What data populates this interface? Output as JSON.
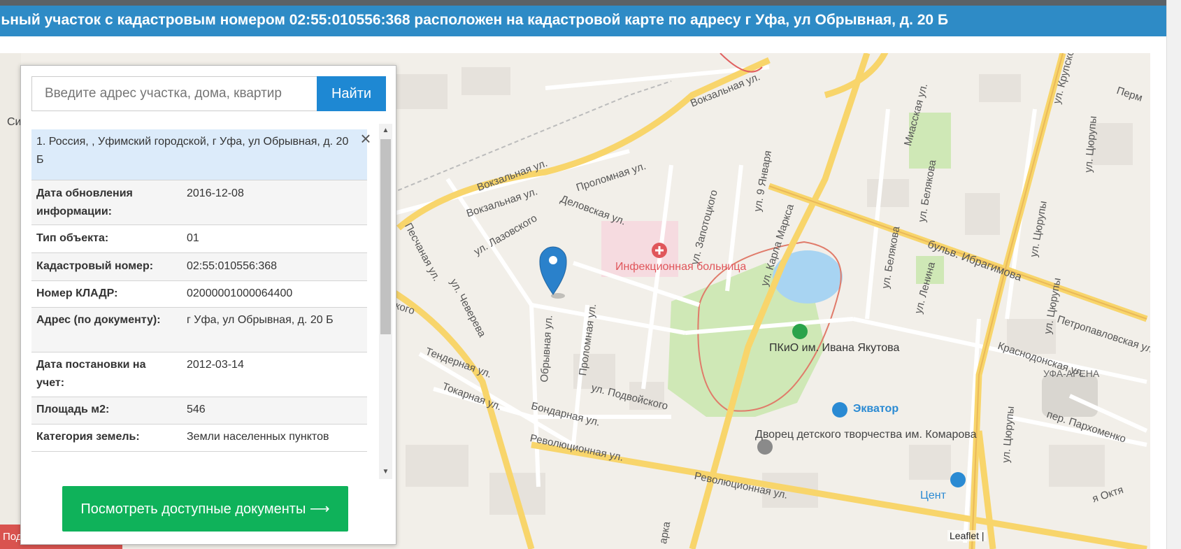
{
  "header": {
    "title_prefix": "льный участок с кадастровым номером ",
    "cadastral_number": "02:55:010556:368",
    "title_middle": " расположен на кадастровой карте по адресу г Уфа, ул Обрывная, д. 20 Б"
  },
  "search": {
    "placeholder": "Введите адрес участка, дома, квартир",
    "button_label": "Найти"
  },
  "result": {
    "heading": "1. Россия, , Уфимский городской, г Уфа, ул Обрывная, д. 20 Б",
    "close_icon": "×",
    "rows": [
      {
        "label": "Дата обновления информации:",
        "value": "2016-12-08"
      },
      {
        "label": "Тип объекта:",
        "value": "01"
      },
      {
        "label": "Кадастровый номер:",
        "value": "02:55:010556:368"
      },
      {
        "label": "Номер КЛАДР:",
        "value": "02000001000064400"
      },
      {
        "label": "Адрес (по документу):",
        "value": "г Уфа, ул Обрывная, д. 20 Б"
      },
      {
        "label": "Дата постановки на учет:",
        "value": "2012-03-14"
      },
      {
        "label": "Площадь м2:",
        "value": "546"
      },
      {
        "label": "Категория земель:",
        "value": "Земли населенных пунктов"
      }
    ]
  },
  "docs_button": "Посмотреть доступные документы ⟶",
  "share_button": "Поделиться ссылкой",
  "map": {
    "attribution": "Leaflet |",
    "marker_icon": "map-pin-icon",
    "labels": {
      "vokzalnaya1": "Вокзальная ул.",
      "vokzalnaya2": "Вокзальная ул.",
      "vokzalnaya3": "Вокзальная ул.",
      "prolomnaya1": "Проломная ул.",
      "prolomnaya2": "Проломная ул.",
      "delovskaya": "Деловская ул.",
      "lazovskogo": "ул. Лазовского",
      "peschanaya": "Песчаная ул.",
      "chevereva": "ул. Чеверева",
      "obryvnaya": "Обрывная ул.",
      "tendernaya": "Тендерная ул.",
      "tokarnaya": "Токарная ул.",
      "bondarnaya": "Бондарная ул.",
      "revolutsionnaya1": "Революционная ул.",
      "revolutsionnaya2": "Революционная ул.",
      "podvoyskogo": "ул. Подвойского",
      "zapototskogo": "ул. Запотоцкого",
      "yanvarya": "ул. 9 Января",
      "marksa": "ул. Карла Маркса",
      "lenina": "ул. Ленина",
      "belyakova1": "ул. Белякова",
      "belyakova2": "ул. Белякова",
      "tsyurupy1": "ул. Цюрупы",
      "tsyurupy2": "ул. Цюрупы",
      "tsyurupy3": "ул. Цюрупы",
      "tsyurupy4": "ул. Цюрупы",
      "ibragimova": "бульв. Ибрагимова",
      "petropavlovskaya": "Петропавловская ул.",
      "krasnodonskaya": "Краснодонская ул.",
      "parkhomenko": "пер. Пархоменко",
      "miasskaya": "Миасская ул.",
      "krupskoy": "ул. Крупской",
      "perm": "Перм",
      "hospital": "Инфекционная больница",
      "park": "ПКиО им. Ивана Якутова",
      "ekvator": "Экватор",
      "arena": "УФА-АРЕНА",
      "dvorets": "Дворец детского творчества им. Комарова",
      "center": "Цент",
      "oktyabr": "я Октя",
      "partial_si": "Си",
      "partial_insko": "инского",
      "partial_marksa": "арка"
    }
  }
}
